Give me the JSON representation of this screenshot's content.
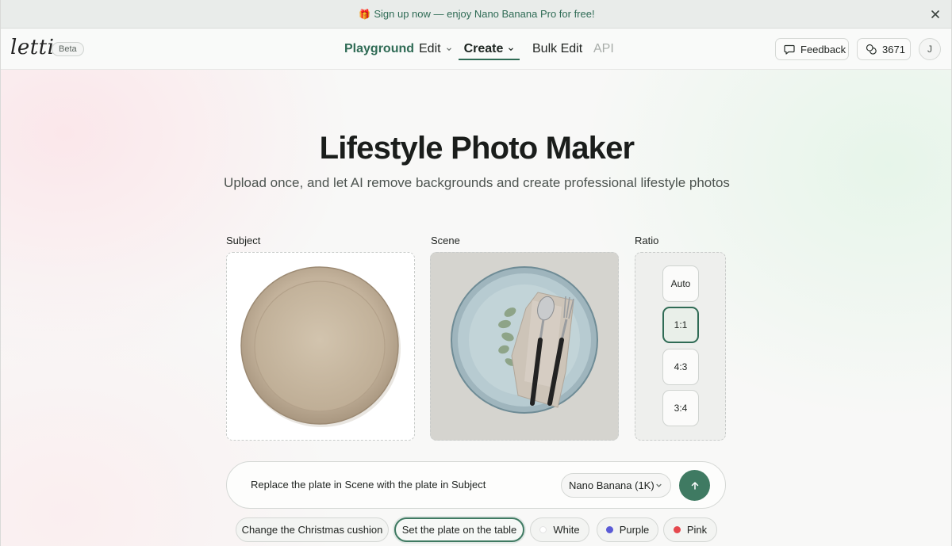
{
  "banner": {
    "gift_icon": "🎁",
    "text": "Sign up now — enjoy Nano Banana Pro for free!"
  },
  "navbar": {
    "logo": "letti",
    "beta": "Beta",
    "items": [
      {
        "label": "Playground"
      },
      {
        "label": "Edit"
      },
      {
        "label": "Create"
      },
      {
        "label": "Bulk Edit"
      },
      {
        "label": "API"
      }
    ],
    "feedback": "Feedback",
    "credits": "3671",
    "avatar": "J"
  },
  "main": {
    "title": "Lifestyle Photo Maker",
    "subtitle": "Upload once, and let AI remove backgrounds and create professional lifestyle photos",
    "subject_label": "Subject",
    "scene_label": "Scene",
    "ratio_label": "Ratio",
    "ratios": [
      "Auto",
      "1:1",
      "4:3",
      "3:4"
    ],
    "selected_ratio": "1:1"
  },
  "prompt": {
    "value": "Replace the plate in Scene with the plate in Subject",
    "model": "Nano Banana (1K)"
  },
  "chips": [
    {
      "label": "Change the Christmas cushion"
    },
    {
      "label": "Set the plate on the table"
    },
    {
      "label": "White",
      "color": "#ffffff"
    },
    {
      "label": "Purple",
      "color": "#5b5bd6"
    },
    {
      "label": "Pink",
      "color": "#e5484d"
    }
  ],
  "colors": {
    "accent": "#2f6b55",
    "send_button": "#3f7a62"
  }
}
